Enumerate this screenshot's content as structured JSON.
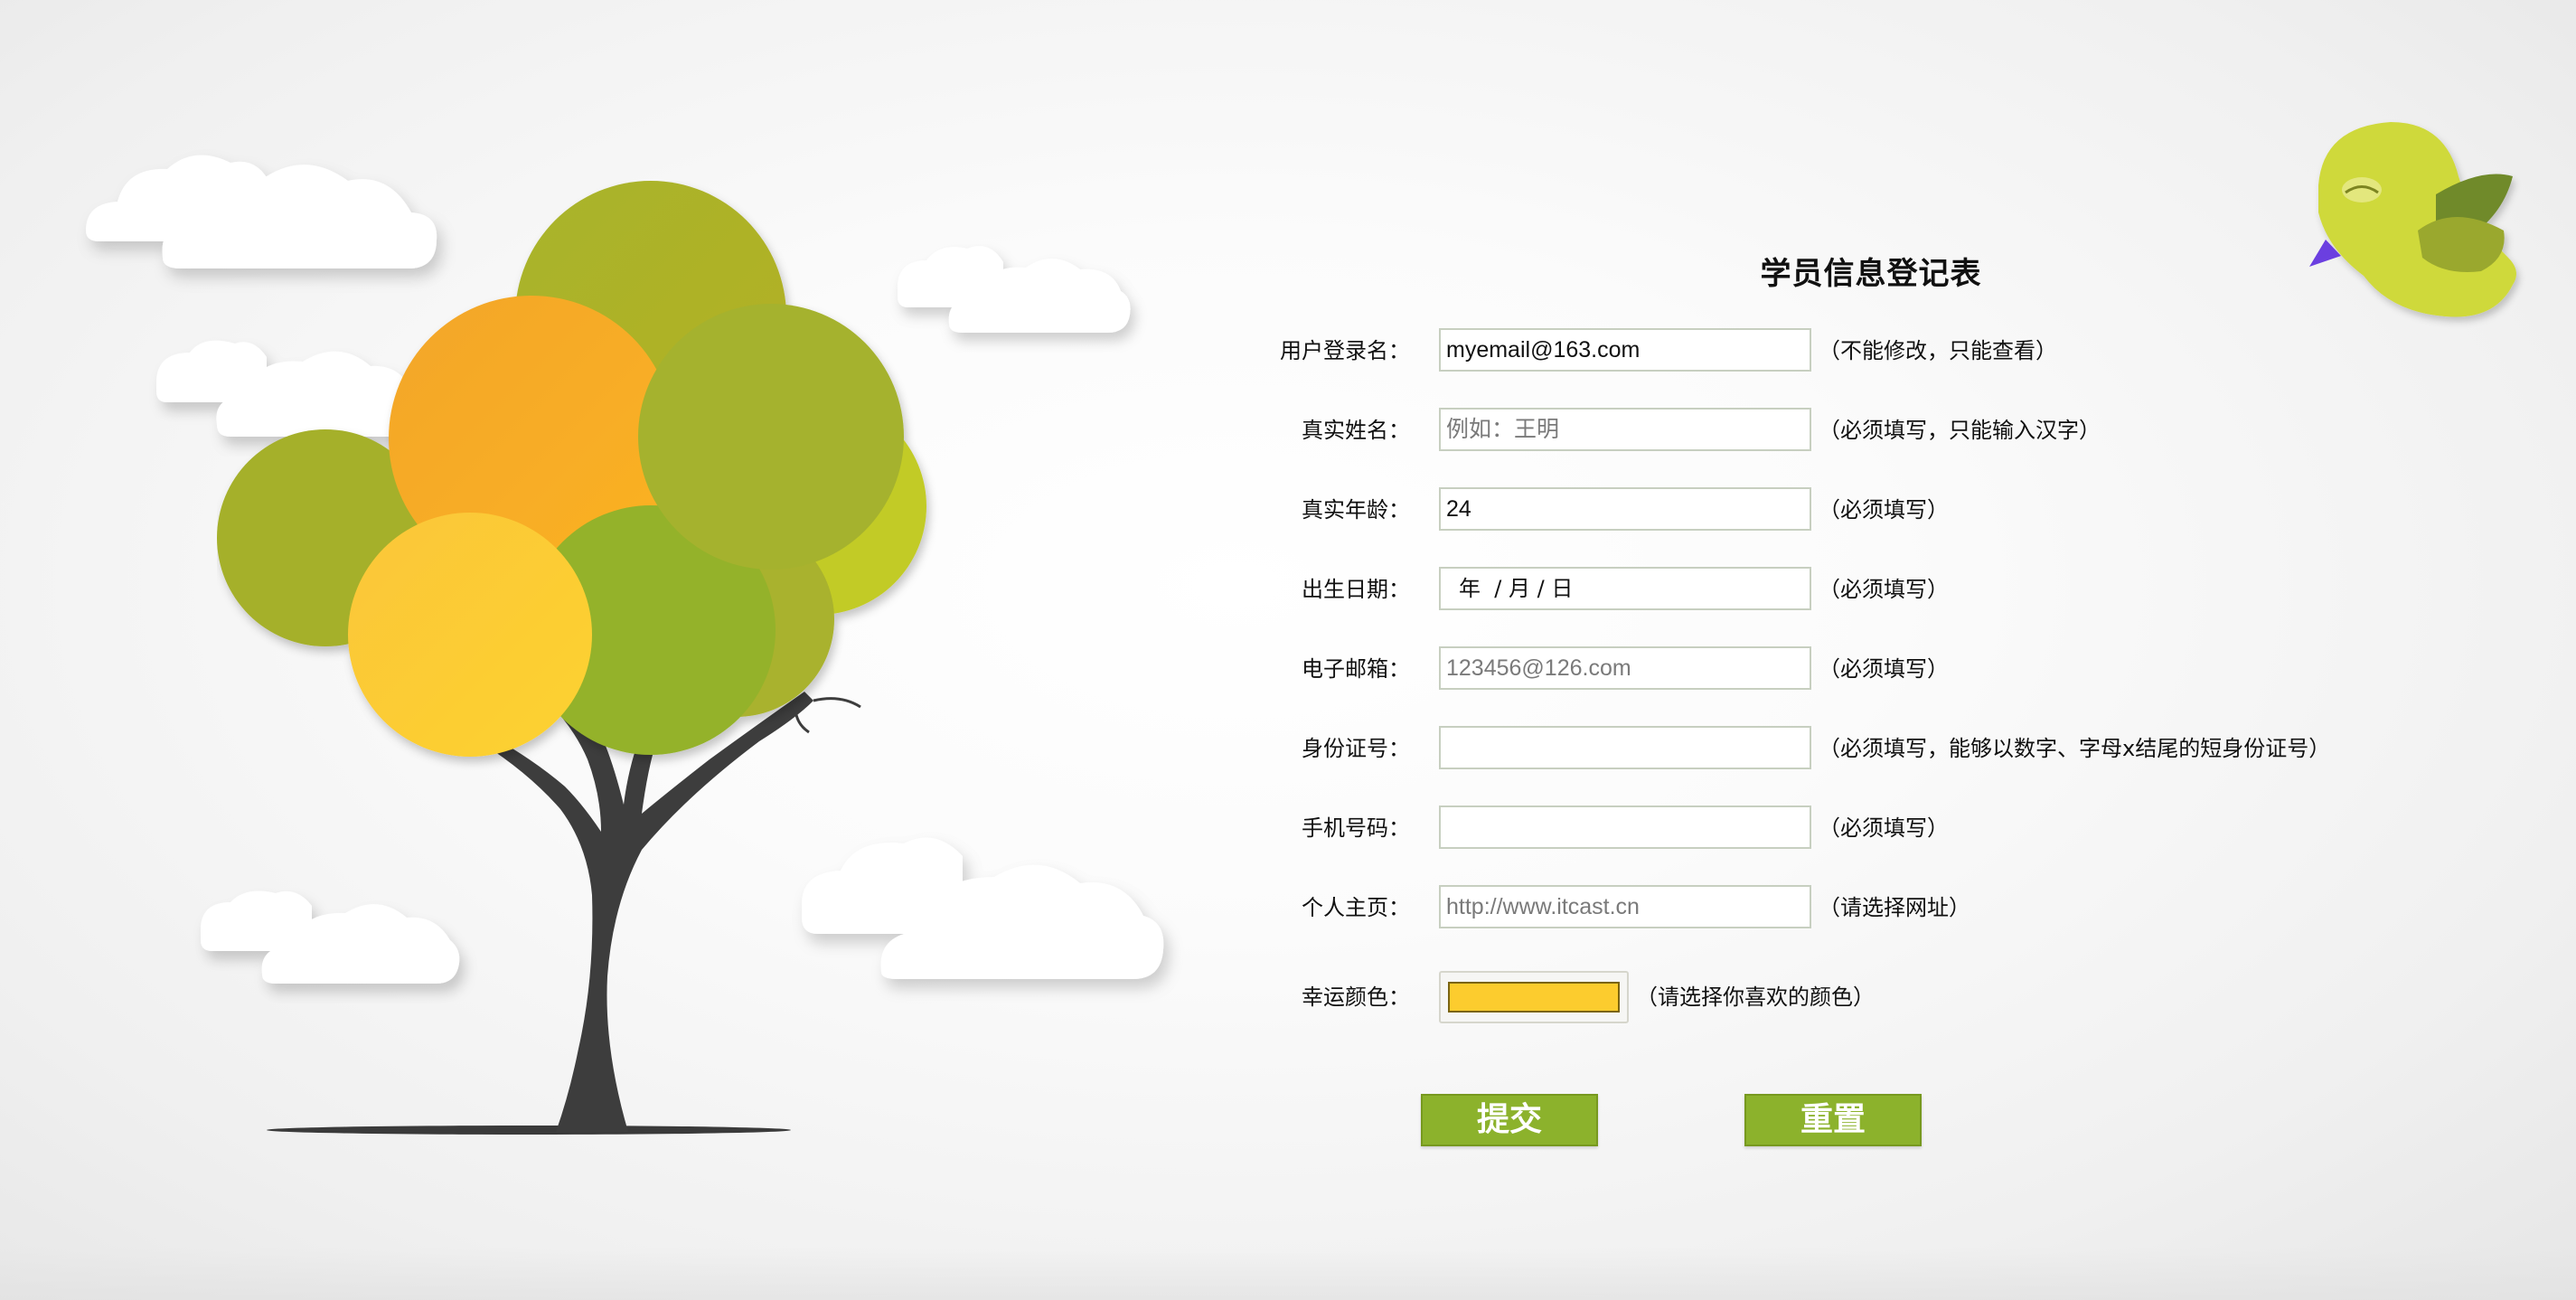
{
  "form": {
    "title": "学员信息登记表",
    "rows": [
      {
        "label": "用户登录名：",
        "value": "myemail@163.com",
        "placeholder": "",
        "hint": "（不能修改，只能查看）"
      },
      {
        "label": "真实姓名：",
        "value": "",
        "placeholder": "例如：王明",
        "hint": "（必须填写，只能输入汉字）"
      },
      {
        "label": "真实年龄：",
        "value": "24",
        "placeholder": "",
        "hint": "（必须填写）"
      },
      {
        "label": "出生日期：",
        "value": "",
        "date_display": "年  / 月 / 日",
        "hint": "（必须填写）"
      },
      {
        "label": "电子邮箱：",
        "value": "",
        "placeholder": "123456@126.com",
        "hint": "（必须填写）"
      },
      {
        "label": "身份证号：",
        "value": "",
        "placeholder": "",
        "hint": "（必须填写，能够以数字、字母x结尾的短身份证号）"
      },
      {
        "label": "手机号码：",
        "value": "",
        "placeholder": "",
        "hint": "（必须填写）"
      },
      {
        "label": "个人主页：",
        "value": "",
        "placeholder": "http://www.itcast.cn",
        "hint": "（请选择网址）"
      },
      {
        "label": "幸运颜色：",
        "color_value": "#fccc2e",
        "hint": "（请选择你喜欢的颜色）"
      }
    ],
    "submit_label": "提交",
    "reset_label": "重置"
  },
  "colors": {
    "button": "#8cb22c",
    "tree_trunk": "#3d3d3d",
    "accent_yellow": "#fccc2e",
    "accent_orange": "#fcae24",
    "accent_green": "#94b32a"
  },
  "decorations": {
    "tree": "tree-illustration",
    "clouds": "cloud-icon",
    "bird": "bird-icon"
  }
}
